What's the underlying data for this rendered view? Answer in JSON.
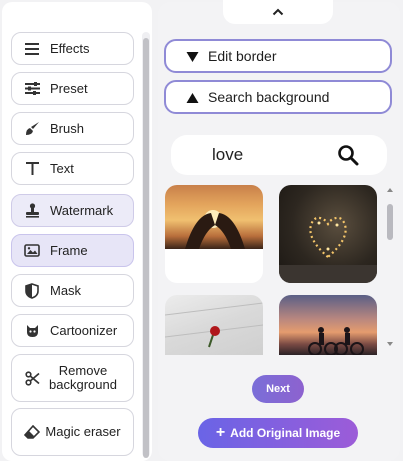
{
  "sidebar": {
    "items": [
      {
        "label": "Effects",
        "icon": "list-icon"
      },
      {
        "label": "Preset",
        "icon": "sliders-icon"
      },
      {
        "label": "Brush",
        "icon": "brush-icon"
      },
      {
        "label": "Text",
        "icon": "text-icon"
      },
      {
        "label": "Watermark",
        "icon": "stamp-icon"
      },
      {
        "label": "Frame",
        "icon": "image-frame-icon"
      },
      {
        "label": "Mask",
        "icon": "shield-icon"
      },
      {
        "label": "Cartoonizer",
        "icon": "cartoon-icon"
      },
      {
        "label": "Remove background",
        "icon": "scissors-icon"
      },
      {
        "label": "Magic eraser",
        "icon": "eraser-icon"
      }
    ],
    "active_item": "Frame"
  },
  "panel": {
    "collapse_icon": "chevron-up-icon",
    "edit_border_label": "Edit border",
    "search_background_label": "Search background",
    "search_query": "love",
    "search_icon": "search-icon",
    "results": [
      {
        "subject": "hands forming heart at sunset"
      },
      {
        "subject": "heart-shaped string lights"
      },
      {
        "subject": "red rose on paper"
      },
      {
        "subject": "couple on bicycles at sunset"
      }
    ],
    "next_label": "Next",
    "add_original_label": "Add Original Image"
  },
  "colors": {
    "accent": "#8f8ad6",
    "button_gradient_start": "#6a64e6",
    "button_gradient_end": "#9c5cd8",
    "active_tool_bg": "#e7e5f7"
  }
}
